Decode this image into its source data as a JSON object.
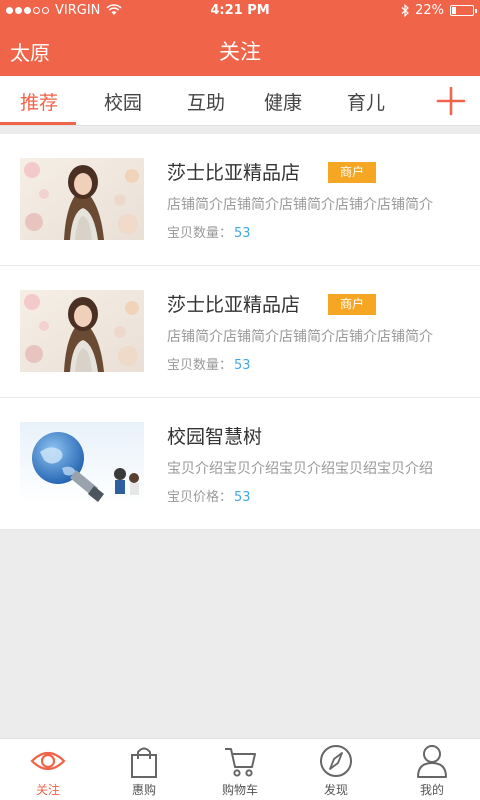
{
  "status_bar": {
    "carrier": "VIRGIN",
    "time": "4:21 PM",
    "battery": "22%",
    "battery_level": 0.22
  },
  "nav": {
    "city": "太原",
    "title": "关注"
  },
  "tabs": [
    {
      "label": "推荐",
      "active": true
    },
    {
      "label": "校园",
      "active": false
    },
    {
      "label": "互助",
      "active": false
    },
    {
      "label": "健康",
      "active": false
    },
    {
      "label": "育儿",
      "active": false
    }
  ],
  "add_icon": "plus-icon",
  "list": [
    {
      "title": "莎士比亚精品店",
      "badge": "商户",
      "desc": "店铺简介店铺简介店铺简介店铺介店铺简介",
      "meta_label": "宝贝数量：",
      "meta_value": "53",
      "image": "woman-portrait-image"
    },
    {
      "title": "莎士比亚精品店",
      "badge": "商户",
      "desc": "店铺简介店铺简介店铺简介店铺介店铺简介",
      "meta_label": "宝贝数量：",
      "meta_value": "53",
      "image": "woman-portrait-image"
    },
    {
      "title": "校园智慧树",
      "badge": "",
      "desc": "宝贝介绍宝贝介绍宝贝介绍宝贝绍宝贝介绍",
      "meta_label": "宝贝价格：",
      "meta_value": "53",
      "image": "lightbulb-globe-image"
    }
  ],
  "tabbar": [
    {
      "label": "关注",
      "icon": "eye-icon",
      "active": true
    },
    {
      "label": "惠购",
      "icon": "shopping-bag-icon",
      "active": false
    },
    {
      "label": "购物车",
      "icon": "cart-icon",
      "active": false
    },
    {
      "label": "发现",
      "icon": "compass-icon",
      "active": false
    },
    {
      "label": "我的",
      "icon": "user-icon",
      "active": false
    }
  ],
  "colors": {
    "accent": "#f0644a",
    "badge": "#f5a623",
    "meta_number": "#40a8e8"
  }
}
